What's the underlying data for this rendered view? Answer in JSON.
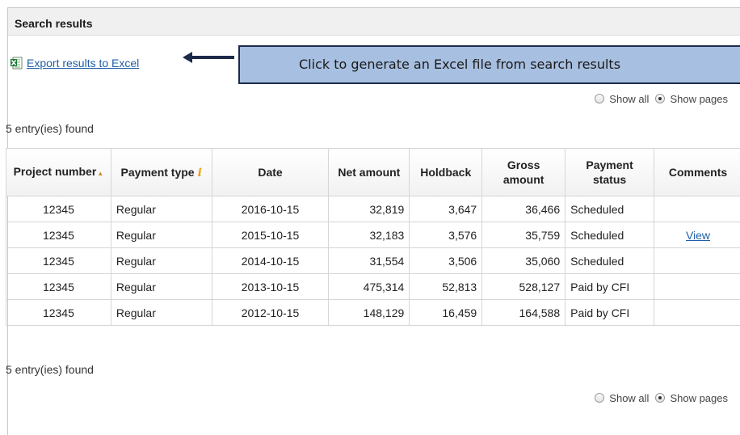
{
  "panel": {
    "title": "Search results"
  },
  "export": {
    "label": "Export results to Excel",
    "icon": "excel-icon"
  },
  "callout": {
    "text": "Click to generate an Excel file from search results"
  },
  "view_options": {
    "show_all": "Show all",
    "show_pages": "Show pages",
    "selected": "Show pages"
  },
  "count_text": "5 entry(ies) found",
  "table": {
    "headers": {
      "project_number": "Project number",
      "payment_type": "Payment type",
      "date": "Date",
      "net_amount": "Net amount",
      "holdback": "Holdback",
      "gross_amount": "Gross amount",
      "payment_status": "Payment status",
      "comments": "Comments"
    },
    "rows": [
      {
        "project": "12345",
        "type": "Regular",
        "date": "2016-10-15",
        "net": "32,819",
        "holdback": "3,647",
        "gross": "36,466",
        "status": "Scheduled",
        "comments": ""
      },
      {
        "project": "12345",
        "type": "Regular",
        "date": "2015-10-15",
        "net": "32,183",
        "holdback": "3,576",
        "gross": "35,759",
        "status": "Scheduled",
        "comments": "View"
      },
      {
        "project": "12345",
        "type": "Regular",
        "date": "2014-10-15",
        "net": "31,554",
        "holdback": "3,506",
        "gross": "35,060",
        "status": "Scheduled",
        "comments": ""
      },
      {
        "project": "12345",
        "type": "Regular",
        "date": "2013-10-15",
        "net": "475,314",
        "holdback": "52,813",
        "gross": "528,127",
        "status": "Paid by CFI",
        "comments": ""
      },
      {
        "project": "12345",
        "type": "Regular",
        "date": "2012-10-15",
        "net": "148,129",
        "holdback": "16,459",
        "gross": "164,588",
        "status": "Paid by CFI",
        "comments": ""
      }
    ]
  }
}
